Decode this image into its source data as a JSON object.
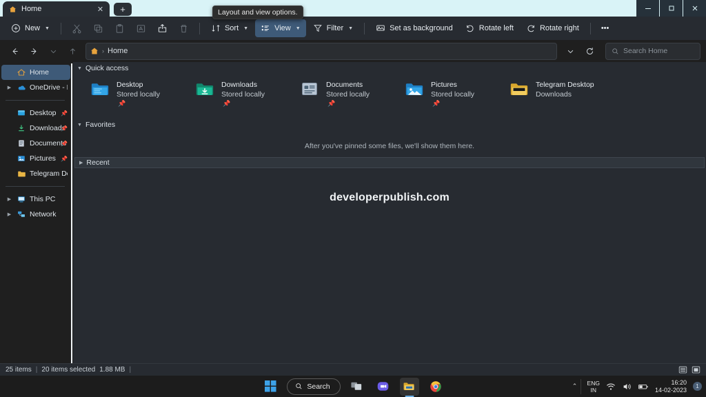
{
  "window": {
    "tab": {
      "title": "Home",
      "icon": "home-icon",
      "close_label": "✕"
    },
    "new_tab_label": "+",
    "controls": {
      "minimize": "–",
      "maximize": "☐",
      "close": "✕"
    }
  },
  "tooltip": {
    "text": "Layout and view options."
  },
  "toolbar": {
    "new_label": "New",
    "cut_label": "Cut",
    "copy_label": "Copy",
    "paste_label": "Paste",
    "rename_label": "Rename",
    "share_label": "Share",
    "delete_label": "Delete",
    "sort_label": "Sort",
    "view_label": "View",
    "filter_label": "Filter",
    "set_as_background_label": "Set as background",
    "rotate_left_label": "Rotate left",
    "rotate_right_label": "Rotate right",
    "more_label": "•••"
  },
  "address": {
    "back_label": "←",
    "forward_label": "→",
    "recent_label": "⌄",
    "up_label": "↑",
    "crumb_separator": "›",
    "breadcrumb": "Home",
    "dropdown_label": "⌄",
    "refresh_label": "↻"
  },
  "search": {
    "placeholder": "Search Home",
    "icon": "search-icon"
  },
  "sidebar": {
    "items": [
      {
        "label": "Home",
        "icon": "home-icon",
        "expandable": false,
        "selected": true,
        "pinned": false
      },
      {
        "label": "OneDrive - Persona",
        "icon": "cloud-icon",
        "expandable": true,
        "selected": false,
        "pinned": false
      },
      {
        "label": "Desktop",
        "icon": "desktop-folder-icon",
        "expandable": false,
        "selected": false,
        "pinned": true
      },
      {
        "label": "Downloads",
        "icon": "downloads-icon",
        "expandable": false,
        "selected": false,
        "pinned": true
      },
      {
        "label": "Documents",
        "icon": "documents-icon",
        "expandable": false,
        "selected": false,
        "pinned": true
      },
      {
        "label": "Pictures",
        "icon": "pictures-icon",
        "expandable": false,
        "selected": false,
        "pinned": true
      },
      {
        "label": "Telegram Desktop",
        "icon": "folder-icon",
        "expandable": false,
        "selected": false,
        "pinned": false
      },
      {
        "label": "This PC",
        "icon": "pc-icon",
        "expandable": true,
        "selected": false,
        "pinned": false
      },
      {
        "label": "Network",
        "icon": "network-icon",
        "expandable": true,
        "selected": false,
        "pinned": false
      }
    ]
  },
  "content": {
    "quick_access": {
      "title": "Quick access",
      "expanded": true,
      "tiles": [
        {
          "name": "Desktop",
          "subtitle": "Stored locally",
          "icon": "desktop-folder-icon",
          "pinned": true
        },
        {
          "name": "Downloads",
          "subtitle": "Stored locally",
          "icon": "downloads-folder-icon",
          "pinned": true
        },
        {
          "name": "Documents",
          "subtitle": "Stored locally",
          "icon": "documents-icon",
          "pinned": true
        },
        {
          "name": "Pictures",
          "subtitle": "Stored locally",
          "icon": "pictures-folder-icon",
          "pinned": true
        },
        {
          "name": "Telegram Desktop",
          "subtitle": "Downloads",
          "icon": "folder-icon",
          "pinned": false
        }
      ]
    },
    "favorites": {
      "title": "Favorites",
      "expanded": true,
      "empty_message": "After you've pinned some files, we'll show them here."
    },
    "recent": {
      "title": "Recent",
      "expanded": false
    },
    "watermark": "developerpublish.com"
  },
  "status": {
    "item_count": "25 items",
    "selection": "20 items selected",
    "size": "1.88 MB",
    "separator": "|",
    "details_view_label": "Details view",
    "large_icons_view_label": "Large icons view"
  },
  "taskbar": {
    "start_label": "Start",
    "search_label": "Search",
    "task_view_label": "Task view",
    "teams_label": "Chat",
    "file_explorer_label": "File Explorer",
    "chrome_label": "Google Chrome",
    "tray": {
      "chevron_label": "⌃",
      "language": "ENG",
      "region": "IN",
      "wifi_label": "Network",
      "volume_label": "Volume",
      "battery_label": "Battery",
      "time": "16:20",
      "date": "14-02-2023",
      "notification_count": "1"
    }
  },
  "colors": {
    "titlebar": "#d9f3f7",
    "accent": "#3e5a78",
    "content_bg": "#272b31",
    "sidebar_bg": "#1f1f1f"
  }
}
